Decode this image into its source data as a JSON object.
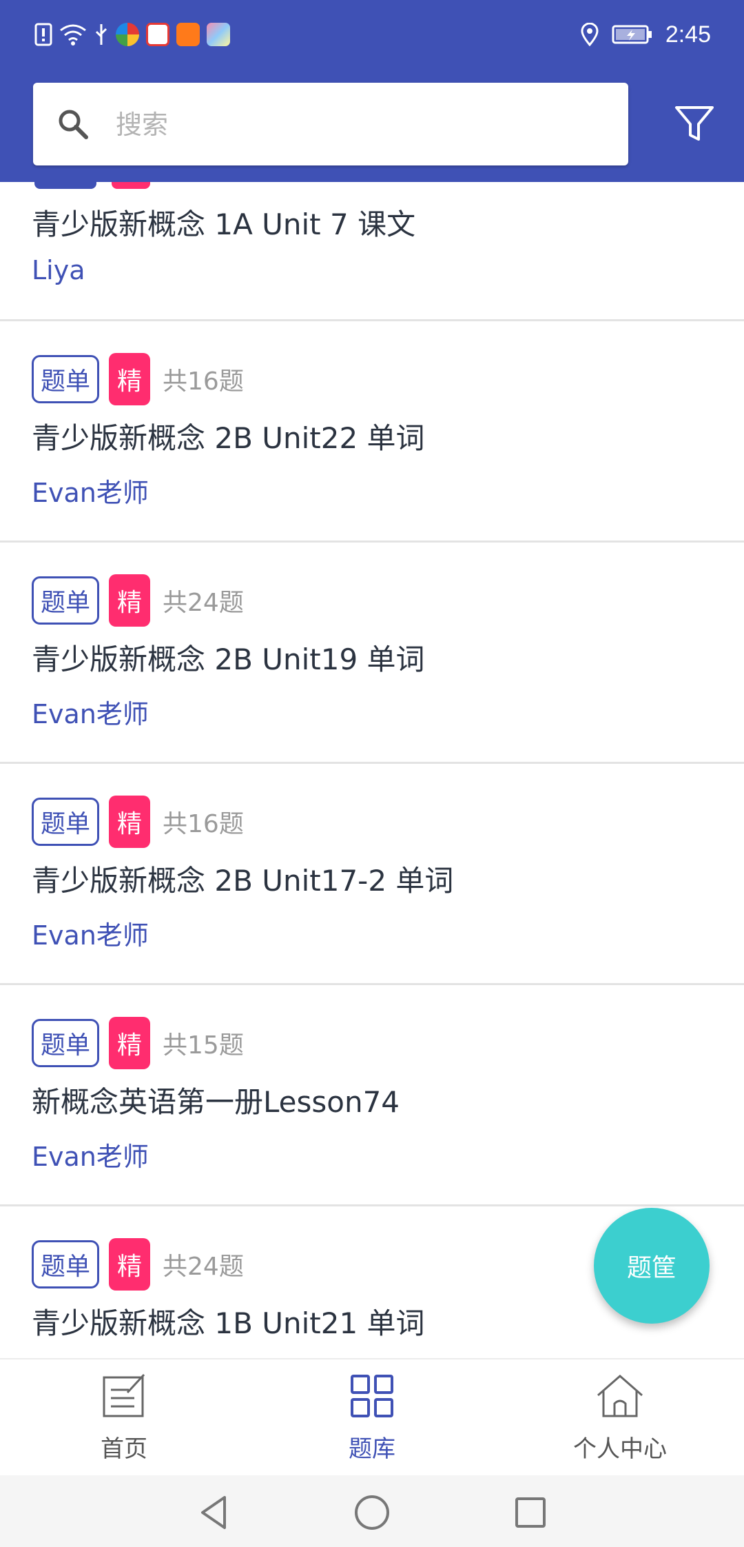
{
  "status_bar": {
    "time": "2:45"
  },
  "search": {
    "placeholder": "搜索"
  },
  "first_item": {
    "title": "青少版新概念 1A  Unit 7 课文",
    "author": "Liya"
  },
  "items": [
    {
      "tag": "题单",
      "badge": "精",
      "count": "共16题",
      "title": "青少版新概念 2B Unit22 单词",
      "author": "Evan老师"
    },
    {
      "tag": "题单",
      "badge": "精",
      "count": "共24题",
      "title": "青少版新概念 2B Unit19 单词",
      "author": "Evan老师"
    },
    {
      "tag": "题单",
      "badge": "精",
      "count": "共16题",
      "title": "青少版新概念 2B Unit17-2 单词",
      "author": "Evan老师"
    },
    {
      "tag": "题单",
      "badge": "精",
      "count": "共15题",
      "title": "新概念英语第一册Lesson74",
      "author": "Evan老师"
    },
    {
      "tag": "题单",
      "badge": "精",
      "count": "共24题",
      "title": "青少版新概念 1B Unit21 单词",
      "author": ""
    }
  ],
  "fab": {
    "label": "题筐"
  },
  "bottom_nav": {
    "home": "首页",
    "library": "题库",
    "profile": "个人中心"
  },
  "colors": {
    "primary": "#3f51b5",
    "accent_badge": "#ff2d6f",
    "fab": "#3ccfcf"
  }
}
